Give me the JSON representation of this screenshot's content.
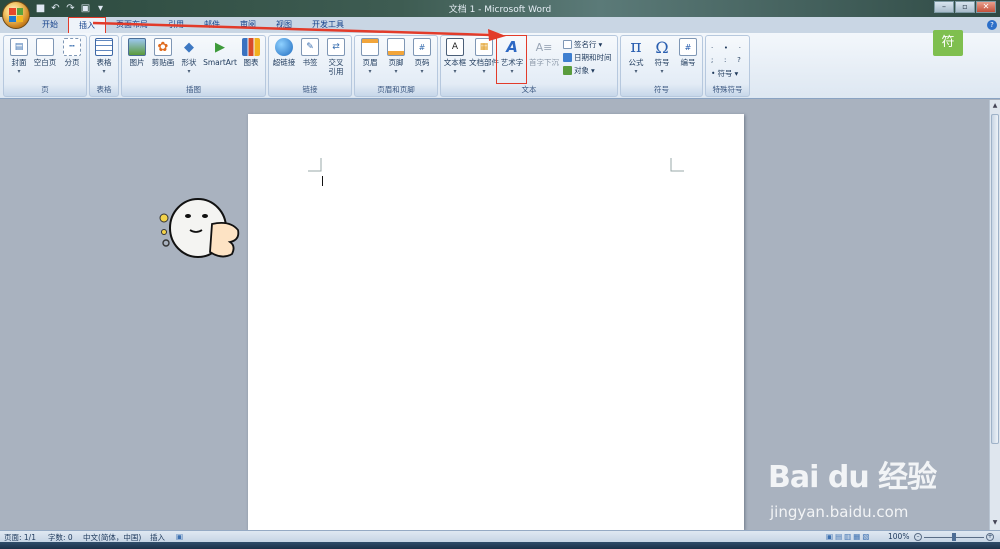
{
  "window": {
    "title": "文档 1 - Microsoft Word"
  },
  "quick_access": [
    {
      "name": "save-icon",
      "glyph": "■"
    },
    {
      "name": "undo-icon",
      "glyph": "↶"
    },
    {
      "name": "redo-icon",
      "glyph": "↷"
    },
    {
      "name": "print-preview-icon",
      "glyph": "▣"
    },
    {
      "name": "customize-qat-icon",
      "glyph": "▾"
    }
  ],
  "tabs": [
    {
      "label": "开始",
      "active": false
    },
    {
      "label": "插入",
      "active": true
    },
    {
      "label": "页面布局",
      "active": false
    },
    {
      "label": "引用",
      "active": false
    },
    {
      "label": "邮件",
      "active": false
    },
    {
      "label": "审阅",
      "active": false
    },
    {
      "label": "视图",
      "active": false
    },
    {
      "label": "开发工具",
      "active": false
    }
  ],
  "ribbon": {
    "groups": {
      "pages": {
        "label": "页",
        "cover": "封面",
        "blank": "空白页",
        "break": "分页"
      },
      "tables": {
        "label": "表格",
        "table": "表格"
      },
      "illustrations": {
        "label": "插图",
        "picture": "图片",
        "clipart": "剪贴画",
        "shapes": "形状",
        "smartart": "SmartArt",
        "chart": "图表"
      },
      "links": {
        "label": "链接",
        "hyperlink": "超链接",
        "bookmark": "书签",
        "crossref_1": "交叉",
        "crossref_2": "引用"
      },
      "header_footer": {
        "label": "页眉和页脚",
        "header": "页眉",
        "footer": "页脚",
        "page_number": "页码"
      },
      "text": {
        "label": "文本",
        "textbox": "文本框",
        "quickparts": "文档部件",
        "wordart": "艺术字",
        "dropcap": "首字下沉",
        "signature": "签名行",
        "datetime": "日期和时间",
        "object": "对象"
      },
      "symbols": {
        "label": "符号",
        "equation": "公式",
        "symbol": "符号",
        "number": "编号"
      },
      "special": {
        "label": "特殊符号",
        "symbol": "符号"
      }
    },
    "addin_badge": "符"
  },
  "statusbar": {
    "page": "页面: 1/1",
    "words": "字数: 0",
    "language": "中文(简体，中国)",
    "mode": "插入",
    "zoom": "100%"
  },
  "watermark": {
    "logo": "Bai du 经验",
    "url": "jingyan.baidu.com"
  },
  "colors": {
    "accent_red": "#e23b2a",
    "ribbon_blue": "#15428b",
    "workspace": "#a9b2bf"
  }
}
